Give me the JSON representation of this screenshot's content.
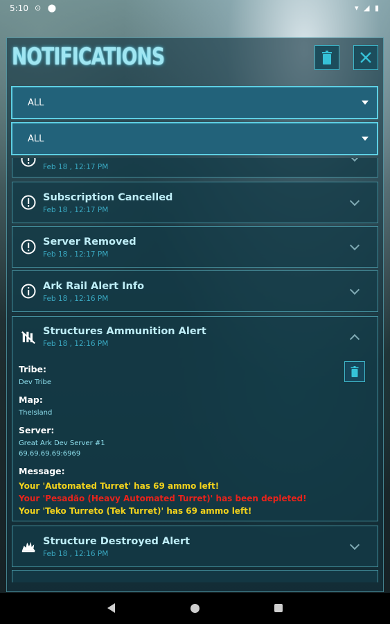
{
  "status_bar": {
    "time": "5:10",
    "left_icons": "⊙ ⬤",
    "right_icons": "▾ ◢ ▮"
  },
  "header": {
    "title": "NOTIFICATIONS"
  },
  "filters": [
    {
      "value": "ALL"
    },
    {
      "value": "ALL"
    }
  ],
  "notifications": [
    {
      "title": "",
      "date": "Feb 18 , 12:17 PM",
      "icon": "exclamation-icon"
    },
    {
      "title": "Subscription Cancelled",
      "date": "Feb 18 , 12:17 PM",
      "icon": "exclamation-icon"
    },
    {
      "title": "Server Removed",
      "date": "Feb 18 , 12:17 PM",
      "icon": "exclamation-icon"
    },
    {
      "title": "Ark Rail Alert Info",
      "date": "Feb 18 , 12:16 PM",
      "icon": "info-icon"
    },
    {
      "title": "Structures Ammunition Alert",
      "date": "Feb 18 , 12:16 PM",
      "icon": "ammunition-icon",
      "details": {
        "tribe_label": "Tribe:",
        "tribe": "Dev Tribe",
        "map_label": "Map:",
        "map": "TheIsland",
        "server_label": "Server:",
        "server_name": "Great Ark Dev Server #1",
        "server_ip": "69.69.69.69:6969",
        "message_label": "Message:",
        "messages": [
          {
            "text": "Your 'Automated Turret' has 69 ammo left!",
            "color": "#f2d21c"
          },
          {
            "text": "Your 'Pesadão (Heavy Automated Turret)' has been depleted!",
            "color": "#e8231b"
          },
          {
            "text": "Your 'Teko Turreto (Tek Turret)' has 69 ammo left!",
            "color": "#f2d21c"
          }
        ]
      }
    },
    {
      "title": "Structure Destroyed Alert",
      "date": "Feb 18 , 12:16 PM",
      "icon": "explosion-icon"
    }
  ],
  "colors": {
    "accent": "#5ecfe3",
    "title_text": "#bfeef7",
    "date_text": "#3aa9c2"
  }
}
